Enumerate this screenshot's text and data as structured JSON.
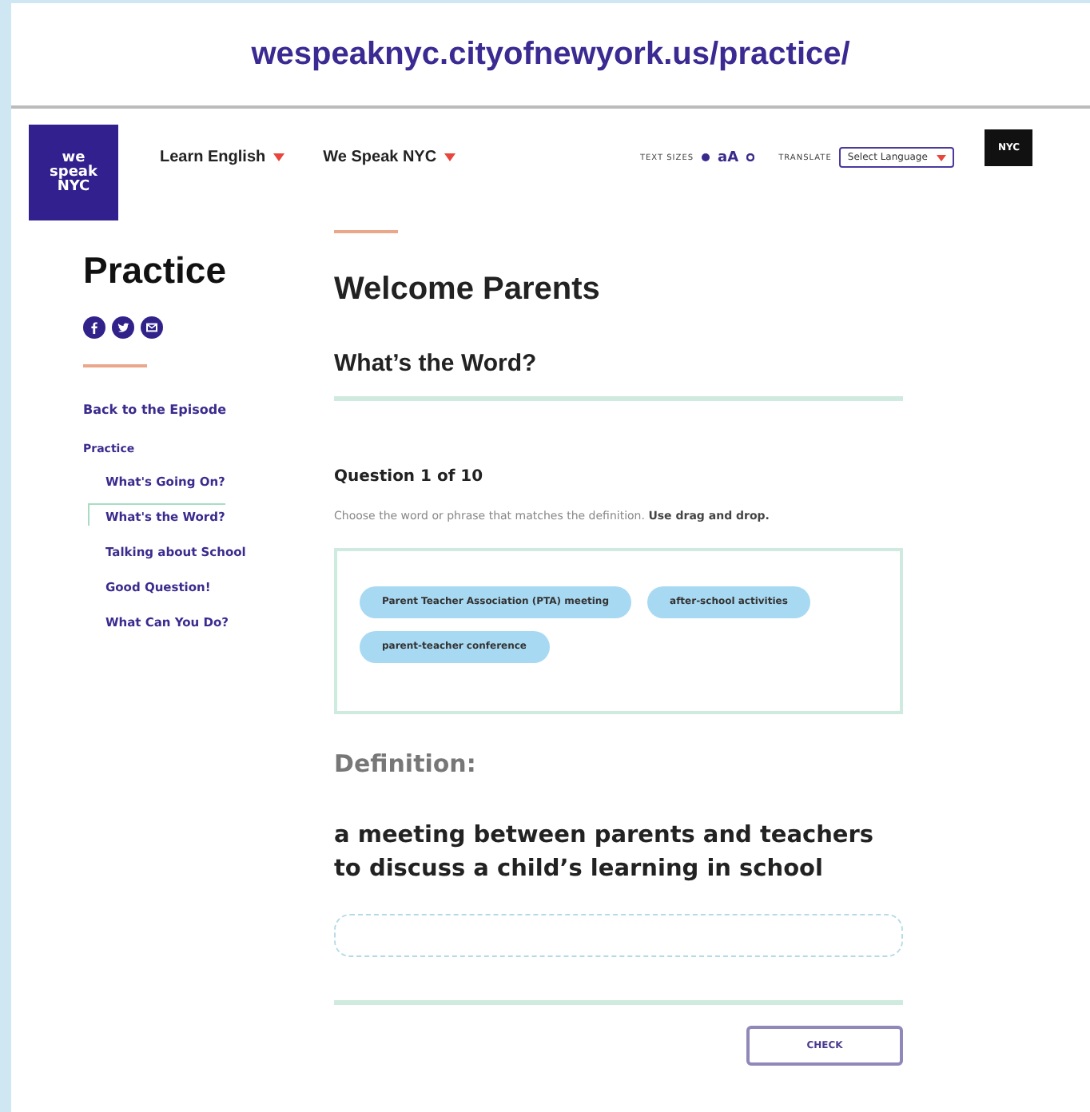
{
  "url_bar": {
    "url": "wespeaknyc.cityofnewyork.us/practice/"
  },
  "header": {
    "logo_text": [
      "we",
      "speak",
      "NYC"
    ],
    "nav": [
      {
        "label": "Learn English"
      },
      {
        "label": "We Speak NYC"
      }
    ],
    "text_sizes_label": "TEXT SIZES",
    "text_size_glyph": "aA",
    "translate_label": "TRANSLATE",
    "language_select": {
      "value": "Select Language"
    },
    "city_logo": "NYC"
  },
  "sidebar": {
    "title": "Practice",
    "back_link": "Back to the Episode",
    "section": "Practice",
    "items": [
      {
        "label": "What's Going On?",
        "selected": false
      },
      {
        "label": "What's the Word?",
        "selected": true
      },
      {
        "label": "Talking about School",
        "selected": false
      },
      {
        "label": "Good Question!",
        "selected": false
      },
      {
        "label": "What Can You Do?",
        "selected": false
      }
    ]
  },
  "main": {
    "title": "Welcome Parents",
    "subtitle": "What’s the Word?",
    "question": "Question 1 of 10",
    "instruction": "Choose the word or phrase that matches the definition. **Use drag and drop.**",
    "choices": [
      "Parent Teacher Association (PTA) meeting",
      "after-school activities",
      "parent-teacher conference"
    ],
    "definition_label": "Definition:",
    "definition": "a meeting between parents and teachers to discuss a child’s learning in school",
    "check_button": "CHECK"
  }
}
